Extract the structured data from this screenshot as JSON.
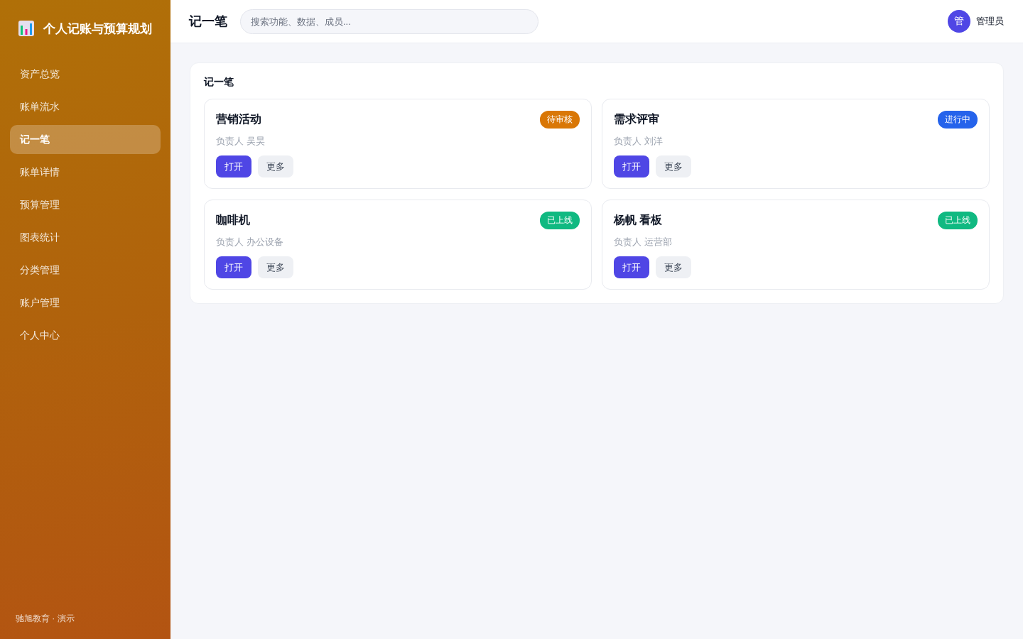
{
  "sidebar": {
    "logo": "个人记账与预算规划",
    "items": [
      {
        "label": "资产总览",
        "selected": false
      },
      {
        "label": "账单流水",
        "selected": false
      },
      {
        "label": "记一笔",
        "selected": true
      },
      {
        "label": "账单详情",
        "selected": false
      },
      {
        "label": "预算管理",
        "selected": false
      },
      {
        "label": "图表统计",
        "selected": false
      },
      {
        "label": "分类管理",
        "selected": false
      },
      {
        "label": "账户管理",
        "selected": false
      },
      {
        "label": "个人中心",
        "selected": false
      }
    ],
    "footer": "驰旭教育 · 演示"
  },
  "header": {
    "title": "记一笔",
    "search": {
      "placeholder": "搜索功能、数据、成员..."
    },
    "user": {
      "avatar": "管",
      "name": "管理员"
    }
  },
  "panel": {
    "title": "记一笔",
    "cards": [
      {
        "title": "营销活动",
        "owner": "负责人 吴昊",
        "status": {
          "label": "待审核",
          "color": "#d97706"
        },
        "actions": [
          {
            "label": "打开",
            "kind": "primary"
          },
          {
            "label": "更多",
            "kind": "secondary"
          }
        ]
      },
      {
        "title": "需求评审",
        "owner": "负责人 刘洋",
        "status": {
          "label": "进行中",
          "color": "#2563eb"
        },
        "actions": [
          {
            "label": "打开",
            "kind": "primary"
          },
          {
            "label": "更多",
            "kind": "secondary"
          }
        ]
      },
      {
        "title": "咖啡机",
        "owner": "负责人 办公设备",
        "status": {
          "label": "已上线",
          "color": "#10b981"
        },
        "actions": [
          {
            "label": "打开",
            "kind": "primary"
          },
          {
            "label": "更多",
            "kind": "secondary"
          }
        ]
      },
      {
        "title": "杨帆 看板",
        "owner": "负责人 运营部",
        "status": {
          "label": "已上线",
          "color": "#10b981"
        },
        "actions": [
          {
            "label": "打开",
            "kind": "primary"
          },
          {
            "label": "更多",
            "kind": "secondary"
          }
        ]
      }
    ]
  }
}
